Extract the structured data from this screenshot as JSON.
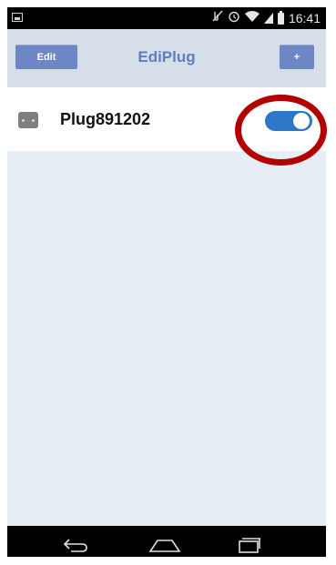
{
  "status_bar": {
    "time": "16:41",
    "icons": [
      "image-icon",
      "mute-icon",
      "alarm-icon",
      "wifi-icon",
      "signal-icon",
      "battery-icon"
    ]
  },
  "header": {
    "title": "EdiPlug",
    "edit_label": "Edit",
    "add_label": "+"
  },
  "devices": [
    {
      "name": "Plug891202",
      "icon": "plug-icon",
      "power_on": true
    }
  ],
  "colors": {
    "accent": "#5e7dc3",
    "button": "#6d86c6",
    "toggle_on": "#2d77c6",
    "highlight": "#b30000"
  },
  "nav_bar": {
    "icons": [
      "back-icon",
      "home-icon",
      "recent-apps-icon"
    ]
  }
}
